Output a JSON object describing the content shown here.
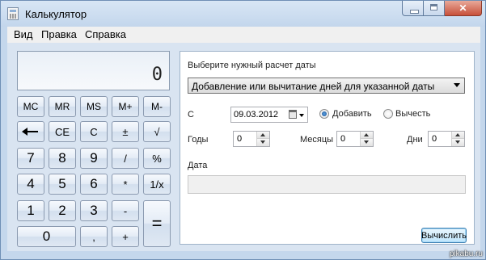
{
  "window": {
    "title": "Калькулятор",
    "icon": "calculator-app-icon"
  },
  "caption_buttons": {
    "minimize": "minimize-icon",
    "maximize": "maximize-icon",
    "close": "✕"
  },
  "menu": {
    "items": [
      "Вид",
      "Правка",
      "Справка"
    ]
  },
  "display": {
    "value": "0"
  },
  "keypad": {
    "mc": "MC",
    "mr": "MR",
    "ms": "MS",
    "mplus": "M+",
    "mminus": "M-",
    "ce": "CE",
    "c": "C",
    "plusminus": "±",
    "sqrt": "√",
    "seven": "7",
    "eight": "8",
    "nine": "9",
    "divide": "/",
    "percent": "%",
    "four": "4",
    "five": "5",
    "six": "6",
    "multiply": "*",
    "reciprocal": "1/x",
    "one": "1",
    "two": "2",
    "three": "3",
    "minus": "-",
    "zero": "0",
    "comma": ",",
    "plus": "+",
    "equals": "=",
    "backspace_icon": "backspace-arrow-icon"
  },
  "date_panel": {
    "prompt_label": "Выберите нужный расчет даты",
    "mode_selected": "Добавление или вычитание дней для указанной даты",
    "from_label": "С",
    "from_date": "09.03.2012",
    "add_label": "Добавить",
    "subtract_label": "Вычесть",
    "add_checked": true,
    "years_label": "Годы",
    "years_value": "0",
    "months_label": "Месяцы",
    "months_value": "0",
    "days_label": "Дни",
    "days_value": "0",
    "result_label": "Дата",
    "result_value": "",
    "calculate_button": "Вычислить"
  },
  "watermark": "pikabu.ru",
  "colors": {
    "window_frame": "#c4d7ec",
    "client_bg": "#d9e4f1",
    "close_button": "#c7503a",
    "default_button_border": "#3c7fb1"
  }
}
